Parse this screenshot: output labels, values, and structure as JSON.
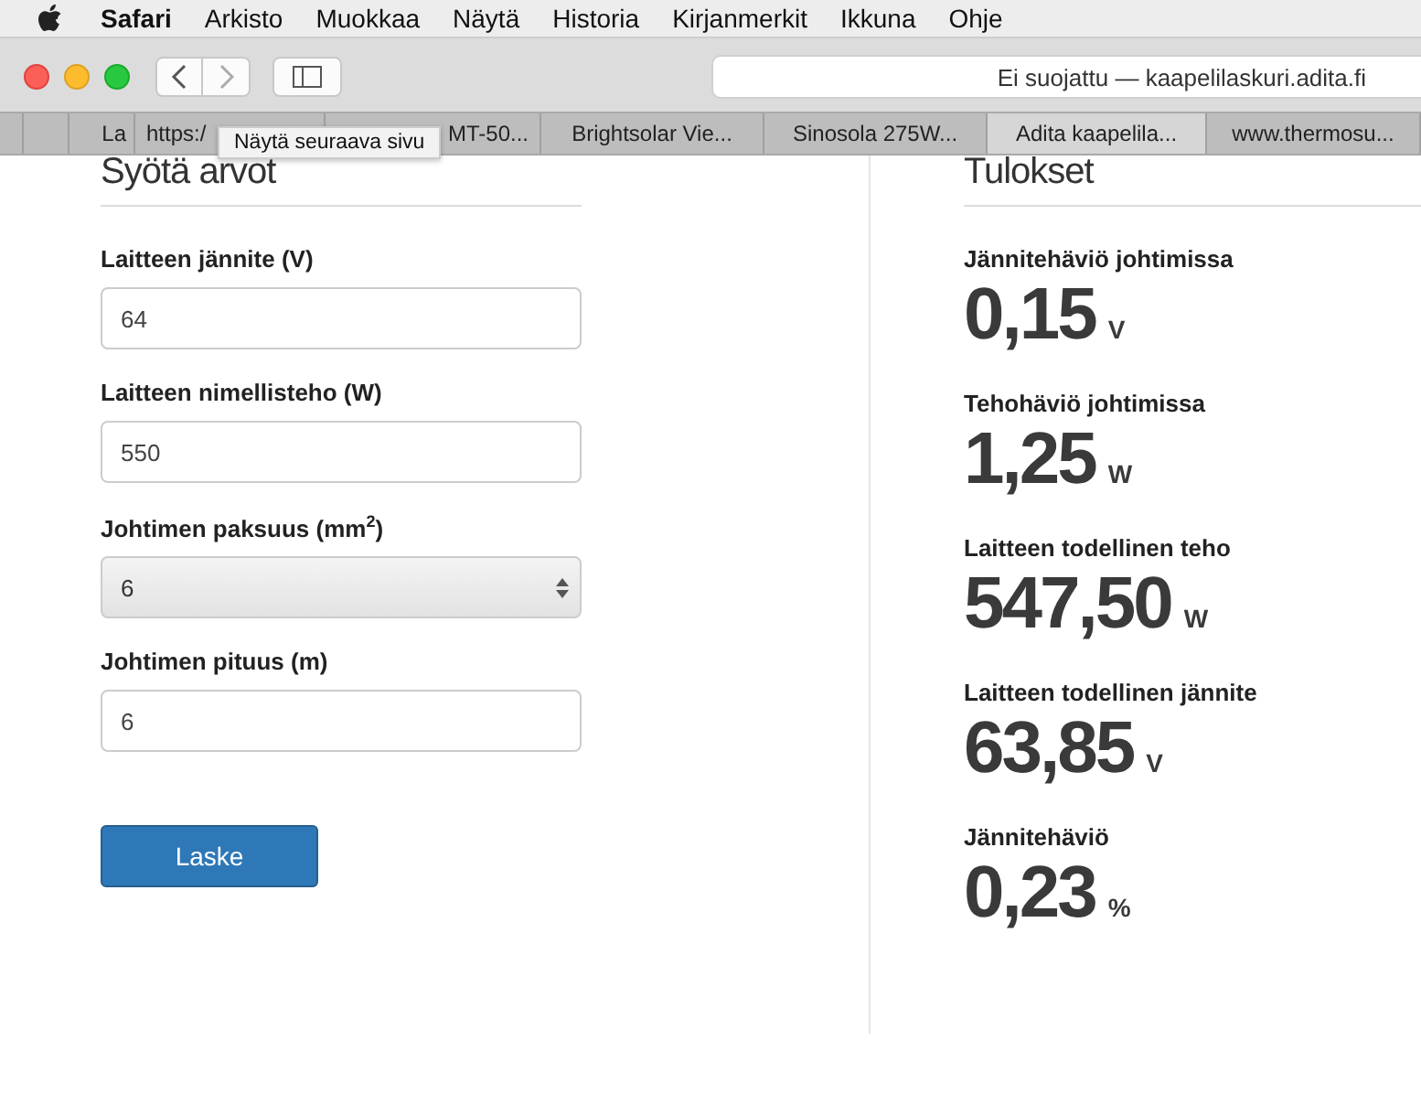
{
  "menu_bar": {
    "items": [
      {
        "label": "Safari",
        "kind": "app"
      },
      {
        "label": "Arkisto",
        "kind": "menu"
      },
      {
        "label": "Muokkaa",
        "kind": "menu"
      },
      {
        "label": "Näytä",
        "kind": "menu"
      },
      {
        "label": "Historia",
        "kind": "menu"
      },
      {
        "label": "Kirjanmerkit",
        "kind": "menu"
      },
      {
        "label": "Ikkuna",
        "kind": "menu"
      },
      {
        "label": "Ohje",
        "kind": "menu"
      }
    ]
  },
  "toolbar": {
    "address": "Ei suojattu — kaapelilaskuri.adita.fi"
  },
  "tabs": [
    {
      "selected": false
    },
    {
      "selected": false
    },
    {
      "label": "La",
      "selected": false
    },
    {
      "label": "https:/",
      "selected": false
    },
    {
      "label": "MT-50...",
      "selected": false
    },
    {
      "label": "Brightsolar Vie...",
      "selected": false
    },
    {
      "label": "Sinosola 275W...",
      "selected": false
    },
    {
      "label": "Adita kaapelila...",
      "selected": true
    },
    {
      "label": "www.thermosu...",
      "selected": false
    }
  ],
  "tooltip": "Näytä seuraava sivu",
  "inputs": {
    "heading": "Syötä arvot",
    "fields": [
      {
        "label": "Laitteen jännite (V)",
        "kind": "input",
        "value": "64"
      },
      {
        "label": "Laitteen nimellisteho (W)",
        "kind": "input",
        "value": "550"
      },
      {
        "label": "Johtimen paksuus (mm$^{2}$)",
        "kind": "select",
        "value": "6"
      },
      {
        "label": "Johtimen pituus (m)",
        "kind": "input",
        "value": "6"
      }
    ],
    "button": "Laske"
  },
  "results": {
    "heading": "Tulokset",
    "items": [
      {
        "label": "Jännitehäviö johtimissa",
        "value": "0,15",
        "unit": "V"
      },
      {
        "label": "Tehohäviö johtimissa",
        "value": "1,25",
        "unit": "W"
      },
      {
        "label": "Laitteen todellinen teho",
        "value": "547,50",
        "unit": "W"
      },
      {
        "label": "Laitteen todellinen jännite",
        "value": "63,85",
        "unit": "V"
      },
      {
        "label": "Jännitehäviö",
        "value": "0,23",
        "unit": "%"
      }
    ]
  }
}
